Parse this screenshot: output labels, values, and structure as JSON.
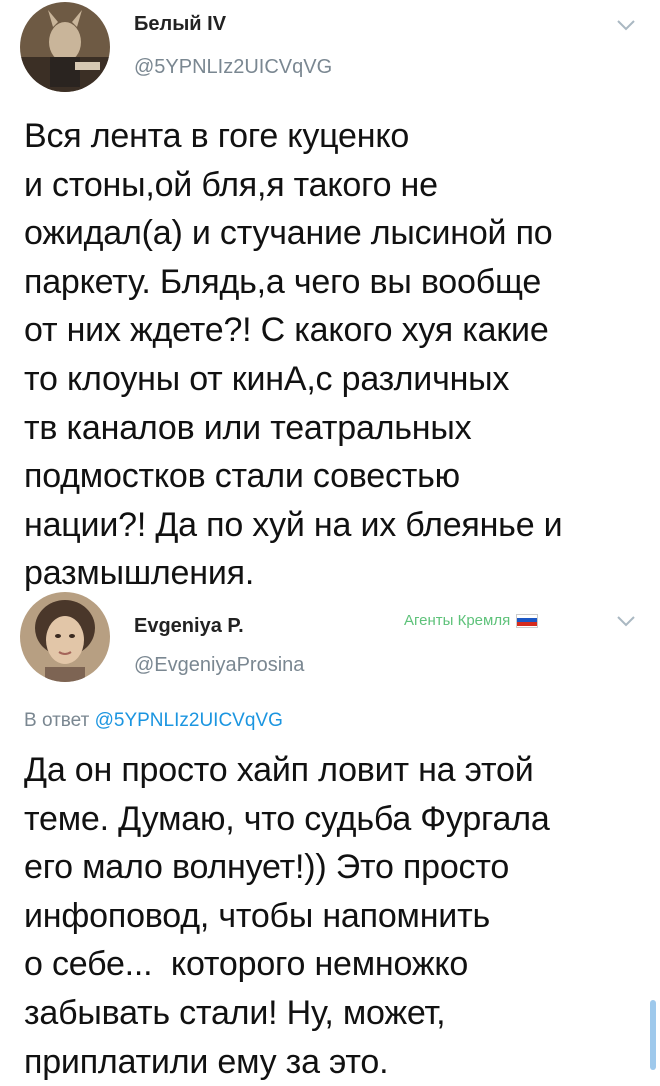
{
  "tweet1": {
    "display_name": "Белый IV",
    "handle": "@5YPNLIz2UICVqVG",
    "text_lines": [
      "Вся лента в гоге куценко",
      "и стоны,ой бля,я такого не",
      "ожидал(а) и стучание лысиной по",
      "паркету. Блядь,а чего вы вообще",
      "от них ждете?! С какого хуя какие",
      "то клоуны от кинА,с различных",
      "тв каналов или театральных",
      "подмостков стали совестью",
      "нации?! Да по хуй на их блеянье и",
      "размышления."
    ],
    "menu_icon": "chevron-down-icon"
  },
  "tweet2": {
    "display_name": "Evgeniya P.",
    "handle": "@EvgeniyaProsina",
    "badge_text": "Агенты Кремля",
    "badge_flag": "russia-flag-icon",
    "badge_color": "#5ec27a",
    "reply_prefix": "В ответ",
    "reply_to": "@5YPNLIz2UICVqVG",
    "text_lines": [
      "Да он просто хайп ловит на этой",
      "теме. Думаю, что судьба Фургала",
      "его мало волнует!)) Это просто",
      "инфоповод, чтобы напомнить",
      "о себе...  которого немножко",
      "забывать стали! Ну, может,",
      "приплатили ему за это."
    ],
    "menu_icon": "chevron-down-icon"
  },
  "colors": {
    "link": "#1b95e0",
    "secondary_text": "#7a8791",
    "primary_text": "#111111"
  }
}
